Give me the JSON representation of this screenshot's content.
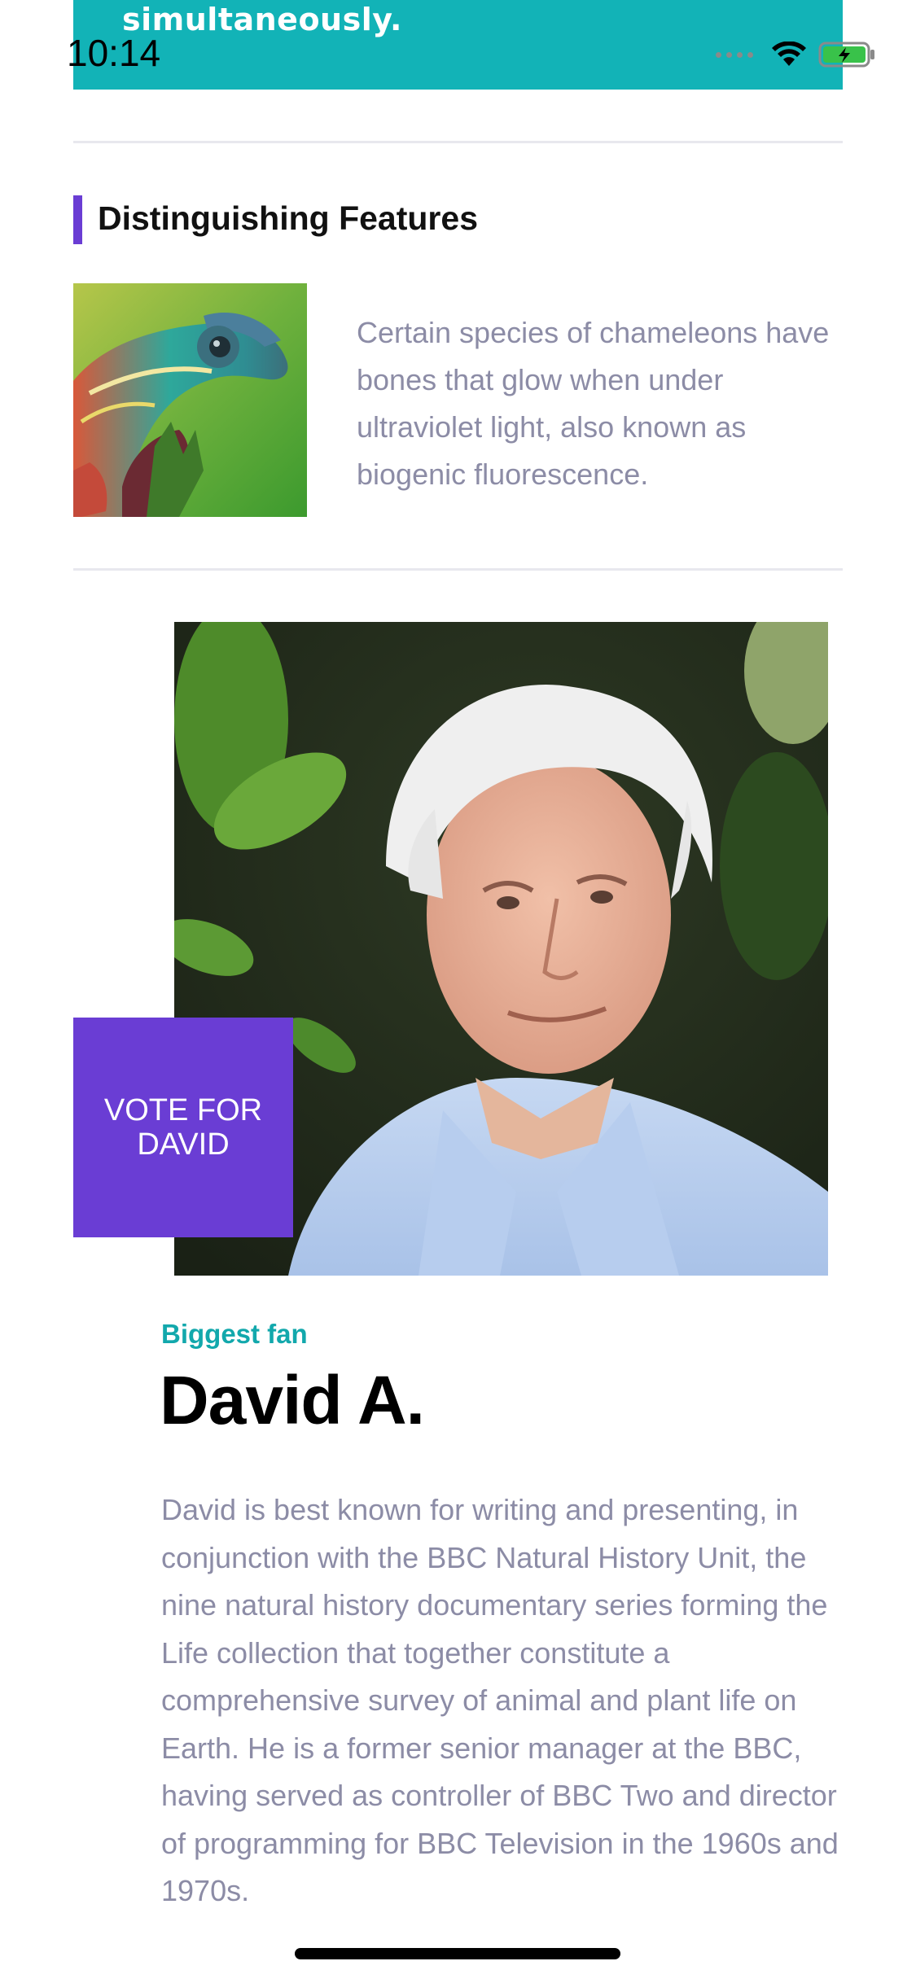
{
  "status_bar": {
    "time": "10:14"
  },
  "banner": {
    "text": "simultaneously."
  },
  "section": {
    "title": "Distinguishing Features",
    "accent_color": "#6a3dd4"
  },
  "feature": {
    "image_icon": "chameleon-image",
    "text": "Certain species of chameleons have bones that glow when under ultraviolet light, also known as biogenic fluorescence."
  },
  "profile": {
    "vote_label": "VOTE FOR\nDAVID",
    "kicker": "Biggest fan",
    "name": "David A.",
    "bio": "David is best known for writing and presenting, in conjunction with the BBC Natural History Unit, the nine natural history documentary series forming the Life collection that together constitute a comprehensive survey of animal and plant life on Earth. He is a former senior manager at the BBC, having served as controller of BBC Two and director of programming for BBC Television in the 1960s and 1970s."
  },
  "colors": {
    "banner": "#12b3b7",
    "accent": "#6a3dd4",
    "kicker": "#12a8ac",
    "body_text": "#8c8ca6"
  }
}
